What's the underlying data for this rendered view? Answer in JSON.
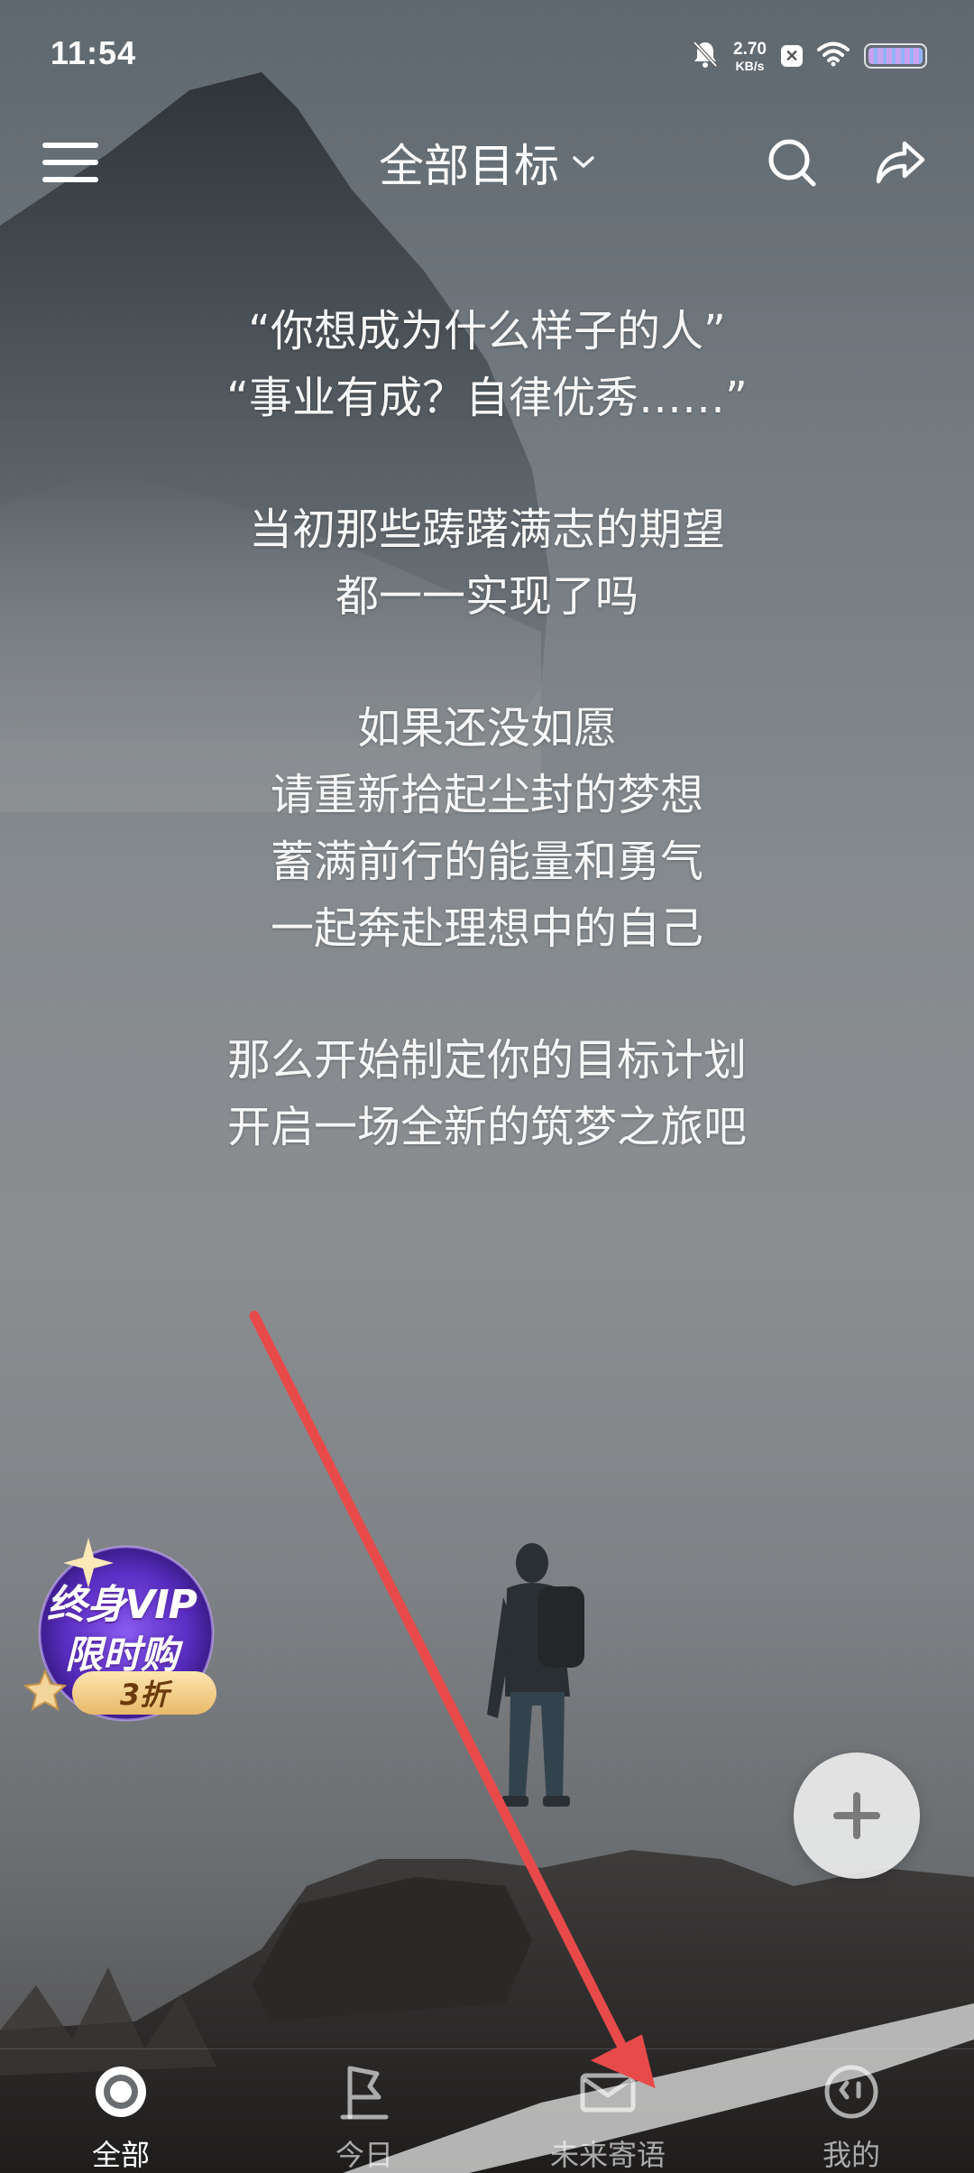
{
  "status_bar": {
    "time": "11:54",
    "net_speed_value": "2.70",
    "net_speed_unit": "KB/s",
    "icons": [
      "bell-muted-icon",
      "app-badge-icon",
      "wifi-icon",
      "battery-icon"
    ]
  },
  "header": {
    "title": "全部目标",
    "icons": [
      "menu-icon",
      "chevron-down-icon",
      "search-icon",
      "share-icon"
    ]
  },
  "intro": {
    "lines": [
      "“你想成为什么样子的人”",
      "“事业有成？自律优秀……”",
      "当初那些踌躇满志的期望",
      "都一一实现了吗",
      "如果还没如愿",
      "请重新拾起尘封的梦想",
      "蓄满前行的能量和勇气",
      "一起奔赴理想中的自己",
      "那么开始制定你的目标计划",
      "开启一场全新的筑梦之旅吧"
    ]
  },
  "vip_badge": {
    "line1": "终身VIP",
    "line2": "限时购",
    "discount": "3折"
  },
  "fab": {
    "icon": "plus-icon"
  },
  "bottom_nav": {
    "items": [
      {
        "label": "全部",
        "icon": "target-icon",
        "active": true
      },
      {
        "label": "今日",
        "icon": "flag-icon",
        "active": false
      },
      {
        "label": "未来寄语",
        "icon": "envelope-icon",
        "active": false
      },
      {
        "label": "我的",
        "icon": "smile-face-icon",
        "active": false
      }
    ]
  },
  "colors": {
    "annotation_arrow": "#e84a4a",
    "vip_purple": "#6a3fd0",
    "vip_gold": "#e9b96a"
  }
}
